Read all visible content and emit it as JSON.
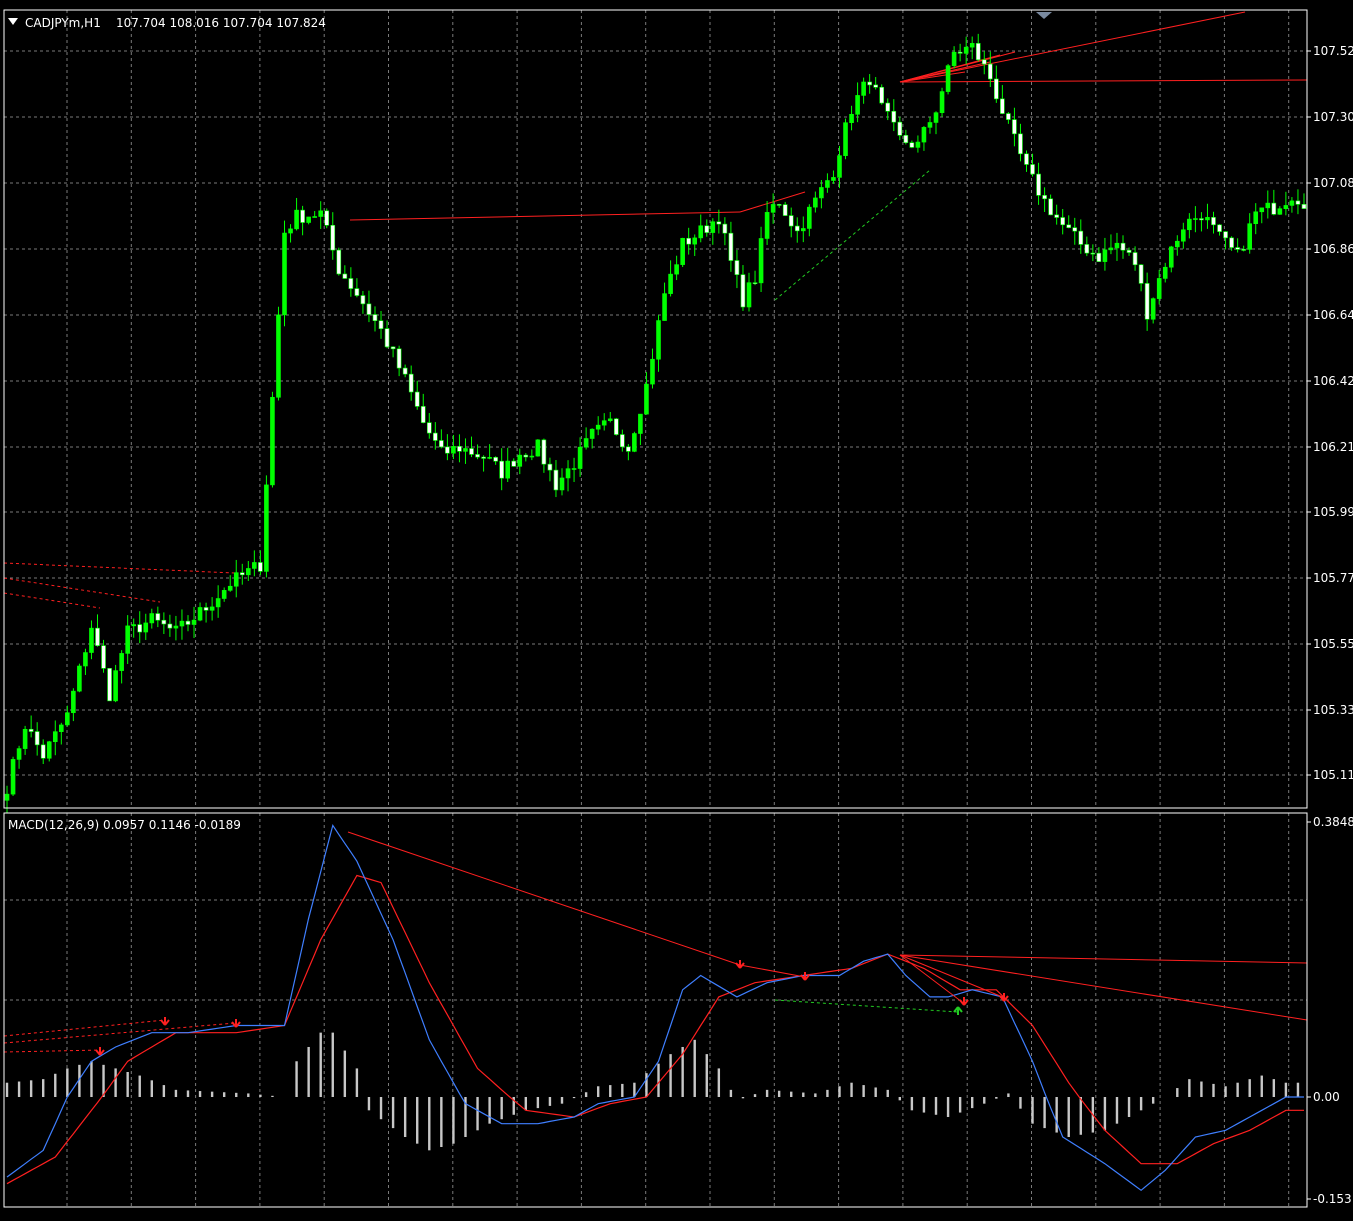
{
  "colors": {
    "background": "#000000",
    "frame": "#ffffff",
    "grid": "#7a7a7a",
    "text": "#ffffff",
    "candle_bull": "#00ff00",
    "candle_bear": "#ffffff",
    "wick": "#00ff00",
    "macd_line": "#3f7fff",
    "signal_line": "#ff2020",
    "histogram": "#c8c8c8",
    "trend_red": "#ff2020",
    "trend_green": "#22cc22"
  },
  "header": {
    "symbol_label": "CADJPYm,H1",
    "ohlc_label": "107.704 108.016 107.704 107.824",
    "dropdown_icon": "triangle-down-icon"
  },
  "indicator": {
    "label": "MACD(12,26,9) 0.0957 0.1146 -0.0189"
  },
  "price_axis": {
    "ticks": [
      "107.52",
      "107.30",
      "107.08",
      "106.86",
      "106.64",
      "106.42",
      "106.21",
      "105.99",
      "105.77",
      "105.55",
      "105.33",
      "105.11"
    ]
  },
  "macd_axis": {
    "ticks": [
      "0.3848",
      "0.00",
      "-0.153"
    ]
  },
  "chart_data": [
    {
      "type": "candlestick",
      "symbol": "CADJPYm",
      "timeframe": "H1",
      "ylim": [
        105.03,
        107.62
      ],
      "grid": true,
      "close_path": [
        [
          0,
          105.1
        ],
        [
          3,
          105.3
        ],
        [
          6,
          105.2
        ],
        [
          10,
          105.33
        ],
        [
          14,
          105.62
        ],
        [
          17,
          105.4
        ],
        [
          20,
          105.6
        ],
        [
          24,
          105.64
        ],
        [
          28,
          105.6
        ],
        [
          33,
          105.68
        ],
        [
          37,
          105.76
        ],
        [
          42,
          105.82
        ],
        [
          46,
          106.9
        ],
        [
          48,
          106.95
        ],
        [
          52,
          106.96
        ],
        [
          55,
          106.78
        ],
        [
          58,
          106.7
        ],
        [
          62,
          106.58
        ],
        [
          66,
          106.42
        ],
        [
          69,
          106.28
        ],
        [
          72,
          106.18
        ],
        [
          75,
          106.2
        ],
        [
          79,
          106.17
        ],
        [
          82,
          106.12
        ],
        [
          85,
          106.18
        ],
        [
          88,
          106.2
        ],
        [
          91,
          106.08
        ],
        [
          94,
          106.15
        ],
        [
          97,
          106.24
        ],
        [
          100,
          106.28
        ],
        [
          103,
          106.2
        ],
        [
          106,
          106.4
        ],
        [
          109,
          106.7
        ],
        [
          112,
          106.86
        ],
        [
          115,
          106.9
        ],
        [
          118,
          106.95
        ],
        [
          120,
          106.8
        ],
        [
          122,
          106.68
        ],
        [
          124,
          106.75
        ],
        [
          126,
          106.96
        ],
        [
          128,
          107.0
        ],
        [
          131,
          106.9
        ],
        [
          134,
          107.0
        ],
        [
          137,
          107.1
        ],
        [
          140,
          107.3
        ],
        [
          143,
          107.4
        ],
        [
          145,
          107.3
        ],
        [
          148,
          107.2
        ],
        [
          151,
          107.18
        ],
        [
          154,
          107.3
        ],
        [
          157,
          107.48
        ],
        [
          160,
          107.5
        ],
        [
          163,
          107.4
        ],
        [
          166,
          107.24
        ],
        [
          169,
          107.1
        ],
        [
          172,
          107.0
        ],
        [
          175,
          106.92
        ],
        [
          178,
          106.86
        ],
        [
          181,
          106.82
        ],
        [
          184,
          106.86
        ],
        [
          187,
          106.8
        ],
        [
          189,
          106.64
        ],
        [
          192,
          106.8
        ],
        [
          195,
          106.92
        ],
        [
          198,
          106.96
        ],
        [
          201,
          106.88
        ],
        [
          204,
          106.82
        ],
        [
          207,
          106.96
        ],
        [
          210,
          106.98
        ],
        [
          213,
          107.02
        ],
        [
          215,
          107.0
        ]
      ]
    },
    {
      "type": "macd",
      "params": "12,26,9",
      "values": {
        "macd": 0.0957,
        "signal": 0.1146,
        "histogram": -0.0189
      },
      "ylim": [
        -0.153,
        0.3848
      ],
      "zero_line": 0.0,
      "macd_path": [
        [
          0,
          -0.12
        ],
        [
          6,
          -0.08
        ],
        [
          10,
          0.0
        ],
        [
          14,
          0.05
        ],
        [
          18,
          0.07
        ],
        [
          24,
          0.09
        ],
        [
          30,
          0.09
        ],
        [
          38,
          0.1
        ],
        [
          46,
          0.1
        ],
        [
          50,
          0.25
        ],
        [
          54,
          0.38
        ],
        [
          58,
          0.33
        ],
        [
          64,
          0.22
        ],
        [
          70,
          0.08
        ],
        [
          76,
          -0.01
        ],
        [
          82,
          -0.04
        ],
        [
          88,
          -0.04
        ],
        [
          94,
          -0.03
        ],
        [
          98,
          -0.01
        ],
        [
          104,
          0.0
        ],
        [
          108,
          0.05
        ],
        [
          112,
          0.15
        ],
        [
          115,
          0.17
        ],
        [
          119,
          0.15
        ],
        [
          121,
          0.14
        ],
        [
          126,
          0.16
        ],
        [
          132,
          0.17
        ],
        [
          138,
          0.17
        ],
        [
          142,
          0.19
        ],
        [
          146,
          0.2
        ],
        [
          149,
          0.17
        ],
        [
          153,
          0.14
        ],
        [
          156,
          0.14
        ],
        [
          160,
          0.15
        ],
        [
          165,
          0.14
        ],
        [
          170,
          0.05
        ],
        [
          175,
          -0.06
        ],
        [
          182,
          -0.1
        ],
        [
          188,
          -0.14
        ],
        [
          192,
          -0.11
        ],
        [
          197,
          -0.06
        ],
        [
          202,
          -0.05
        ],
        [
          208,
          -0.02
        ],
        [
          212,
          0.0
        ]
      ],
      "signal_path": [
        [
          0,
          -0.13
        ],
        [
          8,
          -0.09
        ],
        [
          14,
          -0.02
        ],
        [
          20,
          0.05
        ],
        [
          28,
          0.09
        ],
        [
          38,
          0.09
        ],
        [
          46,
          0.1
        ],
        [
          52,
          0.22
        ],
        [
          58,
          0.31
        ],
        [
          62,
          0.3
        ],
        [
          70,
          0.16
        ],
        [
          78,
          0.04
        ],
        [
          86,
          -0.02
        ],
        [
          94,
          -0.03
        ],
        [
          100,
          -0.01
        ],
        [
          106,
          0.0
        ],
        [
          112,
          0.06
        ],
        [
          118,
          0.14
        ],
        [
          124,
          0.16
        ],
        [
          132,
          0.17
        ],
        [
          140,
          0.18
        ],
        [
          146,
          0.2
        ],
        [
          152,
          0.18
        ],
        [
          158,
          0.15
        ],
        [
          164,
          0.15
        ],
        [
          170,
          0.1
        ],
        [
          176,
          0.02
        ],
        [
          182,
          -0.05
        ],
        [
          188,
          -0.1
        ],
        [
          194,
          -0.1
        ],
        [
          200,
          -0.07
        ],
        [
          206,
          -0.05
        ],
        [
          212,
          -0.02
        ]
      ],
      "histogram_path": [
        [
          0,
          0.02
        ],
        [
          6,
          0.025
        ],
        [
          10,
          0.04
        ],
        [
          14,
          0.05
        ],
        [
          18,
          0.04
        ],
        [
          22,
          0.03
        ],
        [
          28,
          0.01
        ],
        [
          40,
          0.005
        ],
        [
          46,
          0.0
        ],
        [
          48,
          0.05
        ],
        [
          52,
          0.09
        ],
        [
          54,
          0.09
        ],
        [
          58,
          0.04
        ],
        [
          60,
          -0.02
        ],
        [
          66,
          -0.06
        ],
        [
          70,
          -0.08
        ],
        [
          74,
          -0.07
        ],
        [
          80,
          -0.04
        ],
        [
          86,
          -0.02
        ],
        [
          92,
          -0.01
        ],
        [
          98,
          0.015
        ],
        [
          104,
          0.02
        ],
        [
          110,
          0.06
        ],
        [
          114,
          0.08
        ],
        [
          118,
          0.04
        ],
        [
          121,
          -0.005
        ],
        [
          126,
          0.01
        ],
        [
          134,
          0.005
        ],
        [
          140,
          0.02
        ],
        [
          146,
          0.01
        ],
        [
          150,
          -0.02
        ],
        [
          156,
          -0.03
        ],
        [
          162,
          -0.01
        ],
        [
          166,
          0.005
        ],
        [
          170,
          -0.04
        ],
        [
          176,
          -0.06
        ],
        [
          182,
          -0.05
        ],
        [
          188,
          -0.02
        ],
        [
          192,
          0.0
        ],
        [
          196,
          0.025
        ],
        [
          202,
          0.015
        ],
        [
          208,
          0.03
        ],
        [
          212,
          0.02
        ]
      ]
    }
  ]
}
